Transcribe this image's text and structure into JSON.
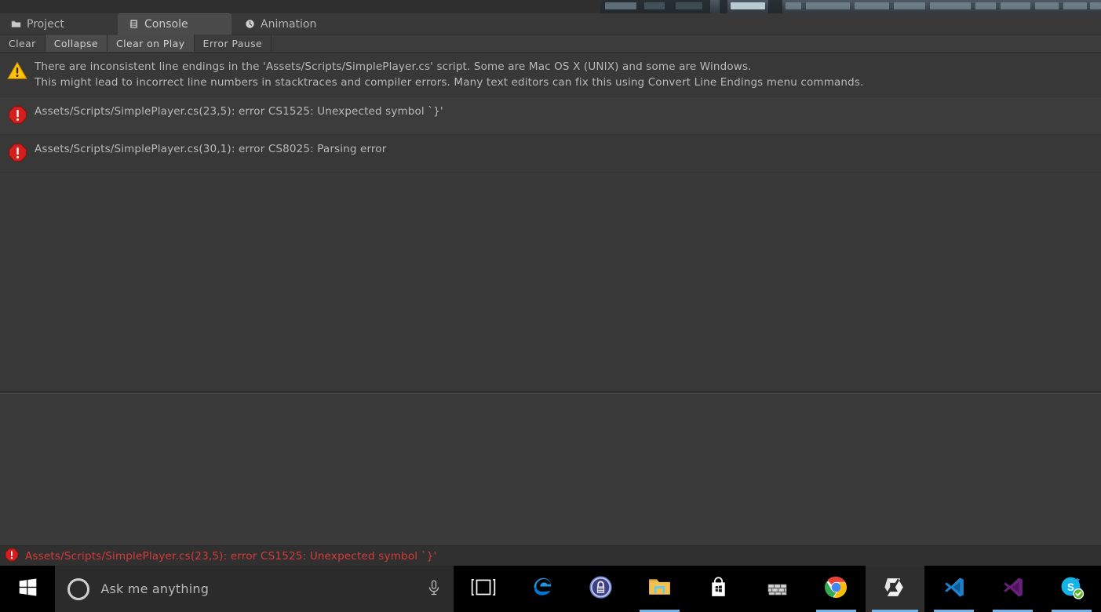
{
  "window": {
    "app": "Unity Editor",
    "panel": "Console"
  },
  "tabs": [
    {
      "label": "Project",
      "icon": "folder-icon",
      "selected": false
    },
    {
      "label": "Console",
      "icon": "console-icon",
      "selected": true
    },
    {
      "label": "Animation",
      "icon": "clock-icon",
      "selected": false
    }
  ],
  "toolbar": {
    "clear_label": "Clear",
    "collapse_label": "Collapse",
    "clear_on_play_label": "Clear on Play",
    "error_pause_label": "Error Pause",
    "collapse_active": true,
    "clear_on_play_active": true
  },
  "messages": [
    {
      "severity": "warning",
      "icon": "warning-triangle-icon",
      "text": "There are inconsistent line endings in the 'Assets/Scripts/SimplePlayer.cs' script. Some are Mac OS X (UNIX) and some are Windows.\nThis might lead to incorrect line numbers in stacktraces and compiler errors. Many text editors can fix this using Convert Line Endings menu commands.",
      "lines": 2
    },
    {
      "severity": "error",
      "icon": "error-octagon-icon",
      "text": "Assets/Scripts/SimplePlayer.cs(23,5): error CS1525: Unexpected symbol `}'",
      "lines": 1
    },
    {
      "severity": "error",
      "icon": "error-octagon-icon",
      "text": "Assets/Scripts/SimplePlayer.cs(30,1): error CS8025: Parsing error",
      "lines": 1
    }
  ],
  "detail_pane": {
    "text": ""
  },
  "statusbar": {
    "icon": "error-octagon-icon",
    "text": "Assets/Scripts/SimplePlayer.cs(23,5): error CS1525: Unexpected symbol `}'",
    "color": "#d83a3a"
  },
  "taskbar": {
    "start_label": "Start",
    "search_placeholder": "Ask me anything",
    "cortana_icon": "cortana-ring-icon",
    "microphone_icon": "microphone-icon",
    "items": [
      {
        "name": "task-view",
        "label": "Task View",
        "running": false,
        "active": false
      },
      {
        "name": "microsoft-edge",
        "label": "Microsoft Edge",
        "running": false,
        "active": false
      },
      {
        "name": "keepass",
        "label": "KeePass",
        "running": false,
        "active": false
      },
      {
        "name": "file-explorer",
        "label": "File Explorer",
        "running": true,
        "active": false
      },
      {
        "name": "microsoft-store",
        "label": "Microsoft Store",
        "running": false,
        "active": false
      },
      {
        "name": "windows-firewall",
        "label": "Windows Firewall",
        "running": false,
        "active": false
      },
      {
        "name": "google-chrome",
        "label": "Google Chrome",
        "running": true,
        "active": false
      },
      {
        "name": "unity",
        "label": "Unity",
        "running": true,
        "active": true
      },
      {
        "name": "visual-studio-code",
        "label": "Visual Studio Code",
        "running": true,
        "active": false
      },
      {
        "name": "visual-studio",
        "label": "Visual Studio",
        "running": true,
        "active": false
      },
      {
        "name": "skype",
        "label": "Skype",
        "running": true,
        "active": false
      }
    ]
  },
  "colors": {
    "panel_bg": "#393939",
    "tab_selected": "#4b4b4b",
    "warning": "#ffc40a",
    "error": "#d41f1f",
    "text": "#b9b9b9"
  }
}
